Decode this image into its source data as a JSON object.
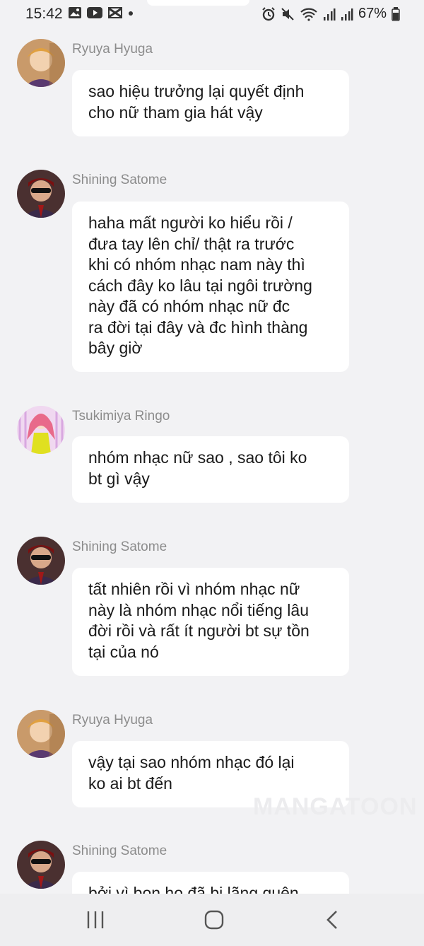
{
  "status_bar": {
    "time": "15:42",
    "battery": "67%",
    "icons": [
      "image-icon",
      "youtube-icon",
      "capcut-icon",
      "dot-icon",
      "alarm-icon",
      "mute-icon",
      "wifi-icon",
      "signal-icon",
      "signal-icon",
      "battery-icon"
    ]
  },
  "messages": [
    {
      "sender": "Ryuya Hyuga",
      "text": "sao hiệu trưởng lại quyết định\ncho nữ tham gia hát vậy"
    },
    {
      "sender": "Shining Satome",
      "text": "haha mất người ko hiểu rồi /\nđưa tay lên chỉ/ thật ra trước\nkhi có nhóm nhạc nam này thì\ncách đây ko lâu tại ngôi trường\nnày đã có nhóm nhạc nữ đc\nra đời tại đây và đc hình thàng\nbây giờ"
    },
    {
      "sender": "Tsukimiya Ringo",
      "text": "nhóm nhạc nữ sao , sao tôi ko\nbt gì vậy"
    },
    {
      "sender": "Shining Satome",
      "text": "tất nhiên rồi vì nhóm nhạc nữ\nnày là nhóm nhạc nổi tiếng lâu\nđời rồi và rất ít người bt sự tồn\ntại của nó"
    },
    {
      "sender": "Ryuya Hyuga",
      "text": "vậy tại sao nhóm nhạc đó lại\nko ai bt đến"
    },
    {
      "sender": "Shining Satome",
      "text": "bởi vì bọn họ đã bị lãng quên"
    }
  ],
  "watermark": "MANGATOON",
  "nav": {
    "icons": [
      "recent-apps-icon",
      "home-icon",
      "back-icon"
    ]
  }
}
